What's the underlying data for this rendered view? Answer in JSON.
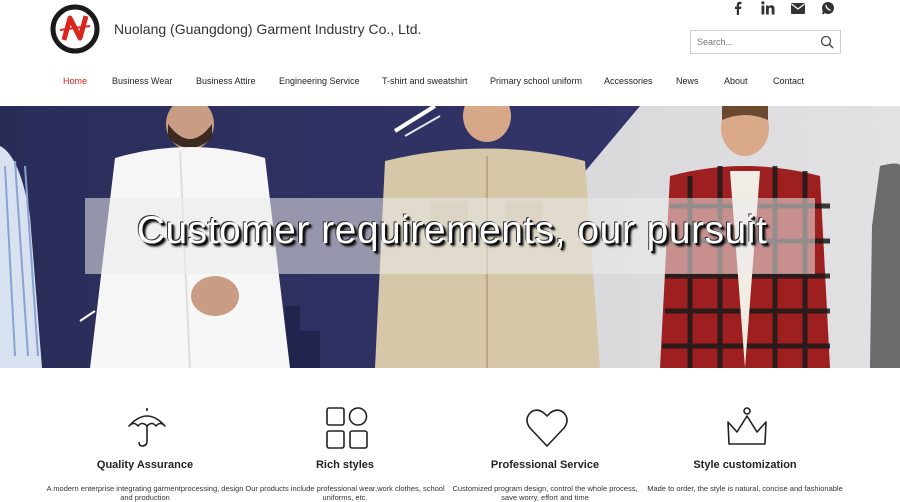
{
  "header": {
    "company_name": "Nuolang (Guangdong) Garment Industry Co., Ltd.",
    "search_placeholder": "Search...",
    "socials": [
      "facebook-icon",
      "linkedin-icon",
      "email-icon",
      "whatsapp-icon"
    ]
  },
  "nav": {
    "items": [
      {
        "label": "Home",
        "active": true
      },
      {
        "label": "Business Wear"
      },
      {
        "label": "Business Attire"
      },
      {
        "label": "Engineering Service"
      },
      {
        "label": "T-shirt and sweatshirt"
      },
      {
        "label": "Primary school uniform"
      },
      {
        "label": "Accessories"
      },
      {
        "label": "News"
      },
      {
        "label": "About"
      },
      {
        "label": "Contact"
      }
    ]
  },
  "hero": {
    "tagline": "Customer requirements, our pursuit"
  },
  "features": [
    {
      "icon": "umbrella-icon",
      "title": "Quality Assurance",
      "desc": "A modern enterprise integrating garmentprocessing, design and production"
    },
    {
      "icon": "grid-icon",
      "title": "Rich styles",
      "desc": "Our products include professional wear,work clothes, school uniforms, etc."
    },
    {
      "icon": "heart-icon",
      "title": "Professional Service",
      "desc": "Customized program design, control the whole process, save worry, effort and time"
    },
    {
      "icon": "crown-icon",
      "title": "Style customization",
      "desc": "Made to order, the style is natural, concise and fashionable"
    }
  ],
  "colors": {
    "accent": "#d9261c",
    "navy": "#2b2d5a"
  }
}
